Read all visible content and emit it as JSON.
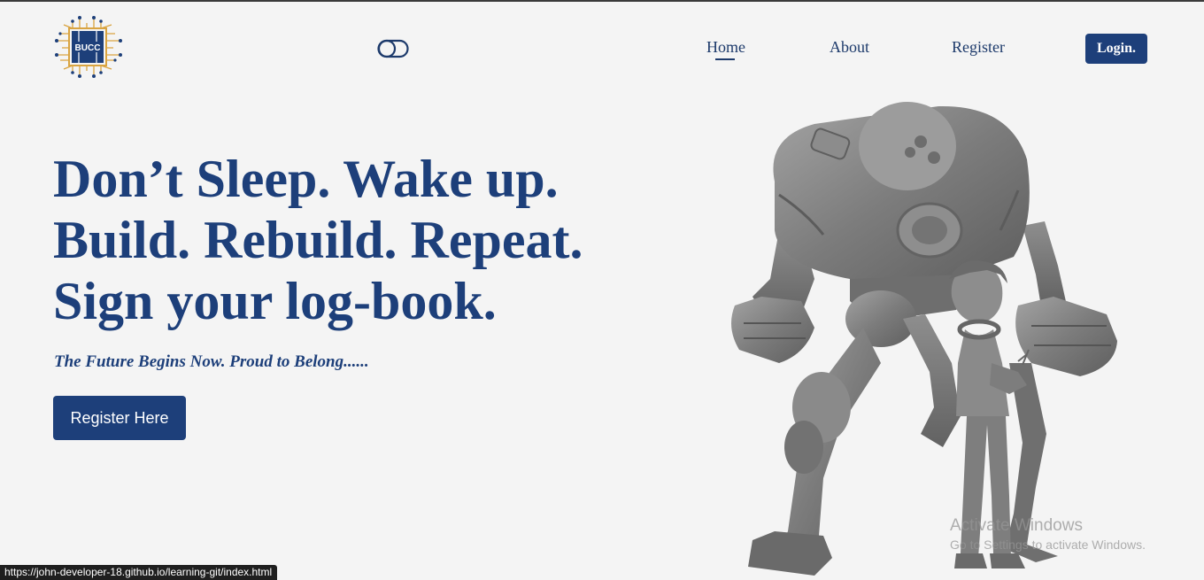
{
  "header": {
    "logo_text": "BUCC",
    "nav": {
      "home": "Home",
      "about": "About",
      "register": "Register"
    },
    "login_label": "Login."
  },
  "hero": {
    "headline": {
      "line1": "Don’t Sleep. Wake up.",
      "line2": "Build. Rebuild. Repeat.",
      "line3": "Sign your log-book."
    },
    "tagline": "The Future Begins Now. Proud to Belong......",
    "cta_label": "Register Here"
  },
  "watermark": {
    "title": "Activate Windows",
    "subtitle": "Go to Settings to activate Windows."
  },
  "status_bar": {
    "url": "https://john-developer-18.github.io/learning-git/index.html"
  },
  "colors": {
    "brand": "#1d3f7a",
    "background": "#f4f4f4",
    "robot_gray": "#7a7a7a",
    "logo_gold": "#d9a441"
  },
  "icons": {
    "theme_toggle": "toggle-icon",
    "logo": "circuit-chip-logo"
  }
}
